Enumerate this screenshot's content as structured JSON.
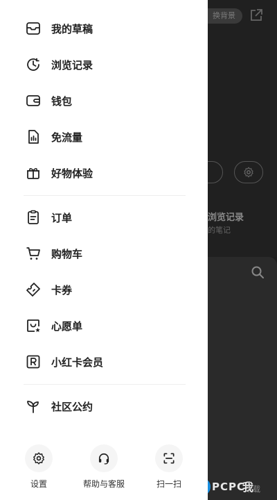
{
  "background": {
    "chip_label": "换背景",
    "history_title": "浏览记录",
    "history_sub": "的笔记",
    "me_label": "我"
  },
  "watermark": {
    "text": "PCPC",
    "sub": "下载"
  },
  "drawer": {
    "group1": [
      {
        "label": "我的草稿",
        "icon": "draft-box-icon"
      },
      {
        "label": "浏览记录",
        "icon": "history-clock-icon"
      },
      {
        "label": "钱包",
        "icon": "wallet-icon"
      },
      {
        "label": "免流量",
        "icon": "data-file-icon"
      },
      {
        "label": "好物体验",
        "icon": "gift-icon"
      }
    ],
    "group2": [
      {
        "label": "订单",
        "icon": "clipboard-icon"
      },
      {
        "label": "购物车",
        "icon": "cart-icon"
      },
      {
        "label": "卡券",
        "icon": "ticket-icon"
      },
      {
        "label": "心愿单",
        "icon": "wishlist-icon"
      },
      {
        "label": "小红卡会员",
        "icon": "member-card-icon"
      }
    ],
    "group3": [
      {
        "label": "社区公约",
        "icon": "sprout-icon"
      }
    ],
    "bottom": [
      {
        "label": "设置",
        "icon": "gear-icon"
      },
      {
        "label": "帮助与客服",
        "icon": "headset-icon"
      },
      {
        "label": "扫一扫",
        "icon": "scan-icon"
      }
    ]
  }
}
